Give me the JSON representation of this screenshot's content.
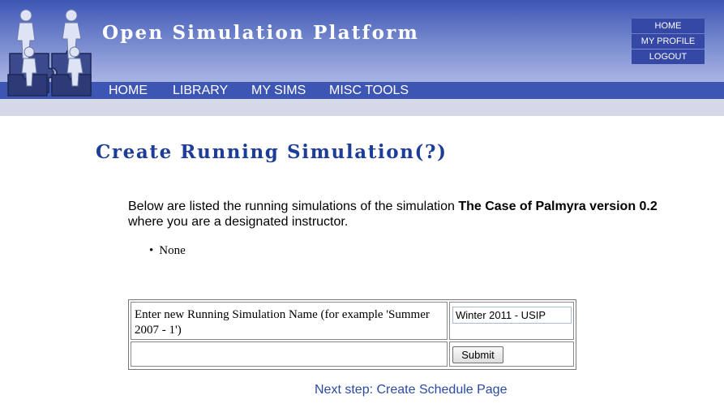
{
  "site": {
    "title": "Open Simulation Platform",
    "colors": {
      "header_dark": "#3d56b4",
      "header_light": "#aab5e4",
      "title_blue": "#1d3d99",
      "link_blue": "#2a4aa5"
    }
  },
  "util_nav": [
    "HOME",
    "MY PROFILE",
    "LOGOUT"
  ],
  "main_nav": [
    "HOME",
    "LIBRARY",
    "MY SIMS",
    "MISC TOOLS"
  ],
  "page": {
    "title": "Create Running Simulation(?)",
    "intro_before": "Below are listed the running simulations of the simulation ",
    "sim_name": "The Case of Palmyra version 0.2",
    "intro_after": " where you are a designated instructor.",
    "running_sims": [
      "None"
    ]
  },
  "form": {
    "name_label": "Enter new Running Simulation Name (for example 'Summer 2007 - 1')",
    "name_value": "Winter 2011 - USIP",
    "submit_label": "Submit"
  },
  "next_step_link": "Next step: Create Schedule Page"
}
